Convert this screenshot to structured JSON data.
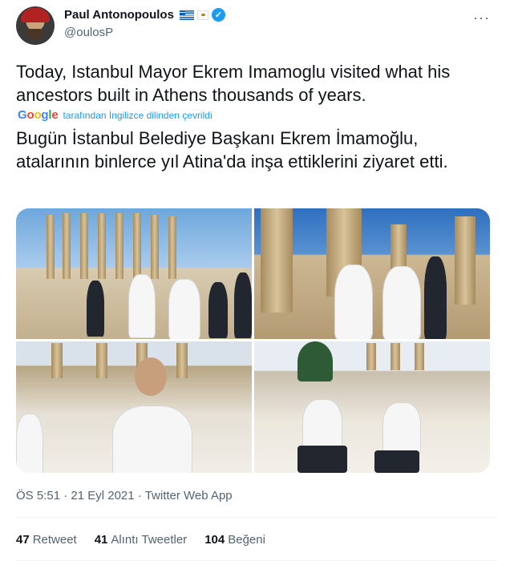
{
  "author": {
    "display_name": "Paul Antonopoulos",
    "handle": "@oulosP",
    "flags": [
      "greece-flag",
      "cyprus-flag"
    ],
    "verified": true
  },
  "menu_icon": "more-options-icon",
  "tweet": {
    "translated_text": "Today, Istanbul Mayor Ekrem Imamoglu visited what his ancestors built in Athens thousands of years.",
    "translation_note": {
      "provider": "Google",
      "label": "tarafından İngilizce dilinden çevrildi"
    },
    "original_text": "Bugün İstanbul Belediye Başkanı Ekrem İmamoğlu, atalarının binlerce yıl Atina'da inşa ettiklerini ziyaret etti."
  },
  "media": {
    "photos": [
      {
        "name": "photo-parthenon-group-walk"
      },
      {
        "name": "photo-propylaea-waving"
      },
      {
        "name": "photo-imamoglu-closeup"
      },
      {
        "name": "photo-seated-on-rocks"
      }
    ]
  },
  "meta": {
    "time": "ÖS 5:51",
    "date": "21 Eyl 2021",
    "source": "Twitter Web App",
    "separator": "·"
  },
  "stats": {
    "retweets": {
      "count": "47",
      "label": "Retweet"
    },
    "quotes": {
      "count": "41",
      "label": "Alıntı Tweetler"
    },
    "likes": {
      "count": "104",
      "label": "Beğeni"
    }
  },
  "colors": {
    "accent": "#1d9bf0",
    "text_primary": "#0f1419",
    "text_secondary": "#536471",
    "divider": "#eff3f4"
  }
}
